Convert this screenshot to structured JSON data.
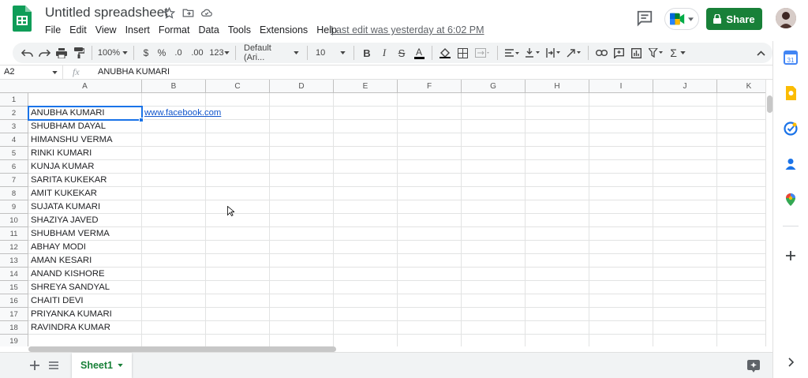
{
  "header": {
    "doc_title": "Untitled spreadsheet",
    "last_edit": "Last edit was yesterday at 6:02 PM",
    "share_label": "Share",
    "menu": [
      "File",
      "Edit",
      "View",
      "Insert",
      "Format",
      "Data",
      "Tools",
      "Extensions",
      "Help"
    ]
  },
  "toolbar": {
    "zoom": "100%",
    "currency": "$",
    "percent": "%",
    "decimal_decrease": ".0",
    "decimal_increase": ".00",
    "more_formats": "123",
    "font": "Default (Ari...",
    "font_size": "10",
    "bold": "B",
    "italic": "I",
    "strike": "S",
    "text_color": "A",
    "sum": "Σ"
  },
  "formula_bar": {
    "name_box": "A2",
    "fx": "fx",
    "value": "ANUBHA KUMARI"
  },
  "columns": [
    "A",
    "B",
    "C",
    "D",
    "E",
    "F",
    "G",
    "H",
    "I",
    "J",
    "K"
  ],
  "rows": [
    "1",
    "2",
    "3",
    "4",
    "5",
    "6",
    "7",
    "8",
    "9",
    "10",
    "11",
    "12",
    "13",
    "14",
    "15",
    "16",
    "17",
    "18",
    "19"
  ],
  "cells": {
    "a2": "ANUBHA KUMARI",
    "b2": "www.facebook.com",
    "a3": "SHUBHAM DAYAL",
    "a4": "HIMANSHU VERMA",
    "a5": "RINKI KUMARI",
    "a6": "KUNJA KUMAR",
    "a7": "SARITA KUKEKAR",
    "a8": "AMIT KUKEKAR",
    "a9": "SUJATA KUMARI",
    "a10": "SHAZIYA JAVED",
    "a11": "SHUBHAM VERMA",
    "a12": "ABHAY MODI",
    "a13": "AMAN KESARI",
    "a14": "ANAND KISHORE",
    "a15": "SHREYA SANDYAL",
    "a16": "CHAITI DEVI",
    "a17": "PRIYANKA KUMARI",
    "a18": "RAVINDRA KUMAR"
  },
  "sheet_tab": "Sheet1",
  "colors": {
    "share_green": "#188038",
    "selection_blue": "#1a73e8",
    "link_blue": "#1155cc"
  }
}
